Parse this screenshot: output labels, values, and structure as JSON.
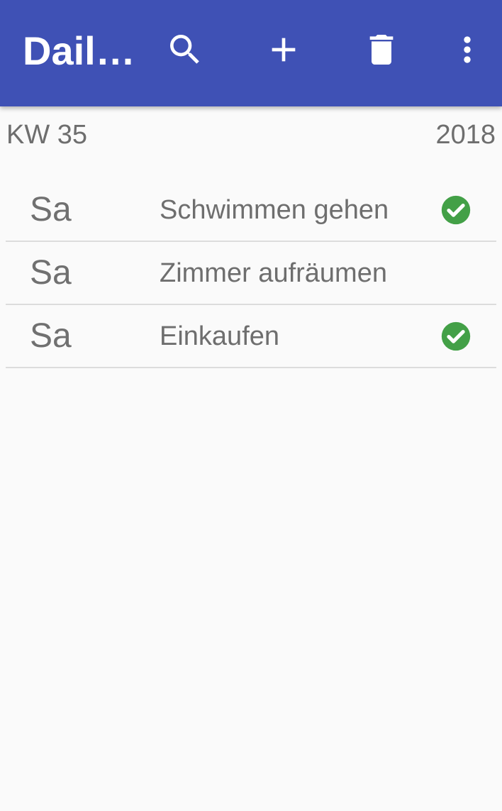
{
  "appbar": {
    "title": "Dail…",
    "color": "#3f51b5",
    "actions": [
      {
        "name": "search",
        "icon": "search-icon"
      },
      {
        "name": "add",
        "icon": "plus-icon"
      },
      {
        "name": "delete",
        "icon": "trash-icon"
      },
      {
        "name": "more",
        "icon": "more-vert-icon"
      }
    ]
  },
  "header": {
    "week": "KW 35",
    "year": "2018"
  },
  "tasks": [
    {
      "day": "Sa",
      "title": "Schwimmen gehen",
      "done": true
    },
    {
      "day": "Sa",
      "title": "Zimmer aufräumen",
      "done": false
    },
    {
      "day": "Sa",
      "title": "Einkaufen",
      "done": true
    }
  ],
  "colors": {
    "check": "#43a047",
    "text": "#6e6e6e",
    "divider": "#dcdcdc"
  }
}
